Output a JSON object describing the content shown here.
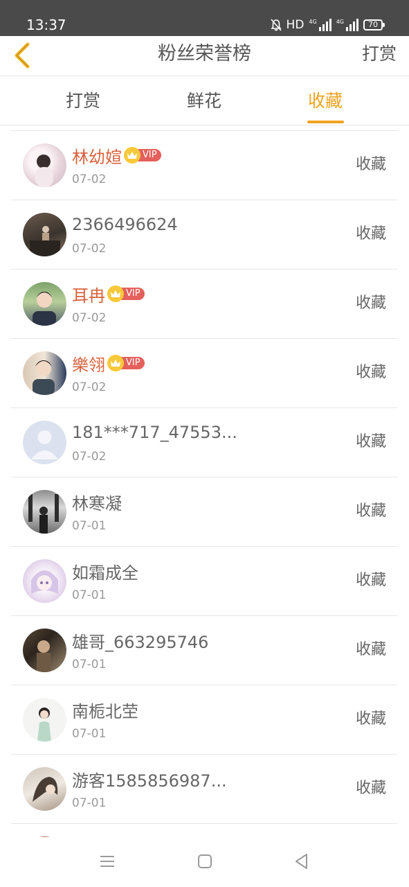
{
  "status_bar": {
    "time": "13:37",
    "hd": "HD",
    "net1": "4G",
    "net2": "4G",
    "battery": "70"
  },
  "header": {
    "title": "粉丝荣誉榜",
    "action": "打赏",
    "back_icon": "chevron-left-icon",
    "back_color": "#f0b429"
  },
  "tabs": [
    {
      "label": "打赏",
      "active": false
    },
    {
      "label": "鲜花",
      "active": false
    },
    {
      "label": "收藏",
      "active": true
    }
  ],
  "accent_color": "#f0a31e",
  "vip_label": "VIP",
  "fans": [
    {
      "name": "林幼媗",
      "vip": true,
      "date": "07-02",
      "action": "收藏"
    },
    {
      "name": "2366496624",
      "vip": false,
      "date": "07-02",
      "action": "收藏"
    },
    {
      "name": "耳冉",
      "vip": true,
      "date": "07-02",
      "action": "收藏"
    },
    {
      "name": "樂翎",
      "vip": true,
      "date": "07-02",
      "action": "收藏"
    },
    {
      "name": "181***717_47553...",
      "vip": false,
      "date": "07-02",
      "action": "收藏"
    },
    {
      "name": "林寒凝",
      "vip": false,
      "date": "07-01",
      "action": "收藏"
    },
    {
      "name": "如霜成全",
      "vip": false,
      "date": "07-01",
      "action": "收藏"
    },
    {
      "name": "雄哥_663295746",
      "vip": false,
      "date": "07-01",
      "action": "收藏"
    },
    {
      "name": "南栀北茔",
      "vip": false,
      "date": "07-01",
      "action": "收藏"
    },
    {
      "name": "游客1585856987...",
      "vip": false,
      "date": "07-01",
      "action": "收藏"
    }
  ],
  "nav_bar": {
    "menu_icon": "menu-icon",
    "home_icon": "home-square-icon",
    "back_icon": "back-triangle-icon"
  }
}
